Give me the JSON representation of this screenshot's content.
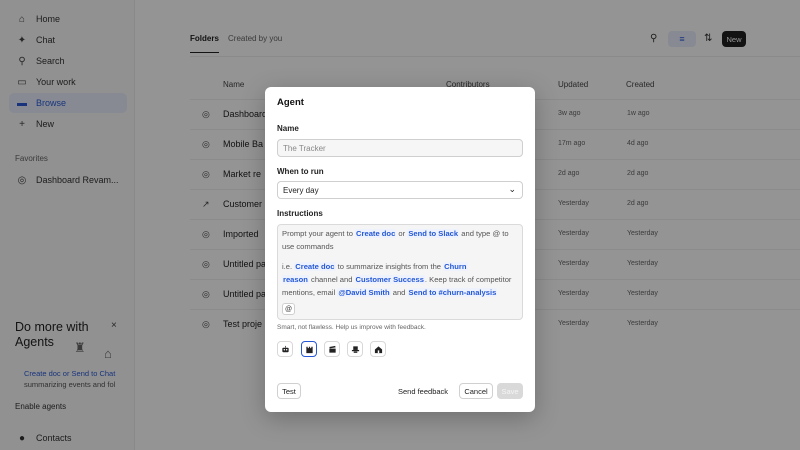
{
  "sidebar": {
    "items": [
      {
        "label": "Home",
        "icon": "home-icon",
        "glyph": "⌂"
      },
      {
        "label": "Chat",
        "icon": "sparkle-icon",
        "glyph": "✦"
      },
      {
        "label": "Search",
        "icon": "search-icon",
        "glyph": "⚲"
      },
      {
        "label": "Your work",
        "icon": "inbox-icon",
        "glyph": "▭"
      },
      {
        "label": "Browse",
        "icon": "folder-icon",
        "glyph": "▬"
      },
      {
        "label": "New",
        "icon": "plus-icon",
        "glyph": "+"
      }
    ],
    "favorites_title": "Favorites",
    "favorite_item": {
      "label": "Dashboard Revam...",
      "icon": "target-icon",
      "glyph": "◎"
    },
    "promo": {
      "title": "Do more with Agents",
      "close": "×",
      "text_1": "Create doc or Send to Chat",
      "text_2": "summarizing events and fol",
      "enable": "Enable agents"
    },
    "contacts": {
      "label": "Contacts",
      "icon": "user-icon",
      "glyph": "●"
    }
  },
  "main": {
    "tabs": [
      "Folders",
      "Created by you"
    ],
    "toolbar": {
      "search_glyph": "⚲",
      "filter_glyph": "≡",
      "sort_glyph": "⇅",
      "new_label": "New"
    },
    "columns": [
      "Name",
      "Contributors",
      "Updated",
      "Created"
    ],
    "rows": [
      {
        "name": "Dashboard",
        "icon": "target-icon",
        "glyph": "◎",
        "updated": "3w ago",
        "created": "1w ago"
      },
      {
        "name": "Mobile Ba",
        "icon": "target-icon",
        "glyph": "◎",
        "updated": "17m ago",
        "created": "4d ago"
      },
      {
        "name": "Market re",
        "icon": "target-icon",
        "glyph": "◎",
        "updated": "2d ago",
        "created": "2d ago"
      },
      {
        "name": "Customer",
        "icon": "trend-icon",
        "glyph": "↗",
        "updated": "Yesterday",
        "created": "2d ago"
      },
      {
        "name": "Imported",
        "icon": "target-icon",
        "glyph": "◎",
        "updated": "Yesterday",
        "created": "Yesterday"
      },
      {
        "name": "Untitled pa",
        "icon": "target-icon",
        "glyph": "◎",
        "updated": "Yesterday",
        "created": "Yesterday"
      },
      {
        "name": "Untitled pa",
        "icon": "target-icon",
        "glyph": "◎",
        "updated": "Yesterday",
        "created": "Yesterday"
      },
      {
        "name": "Test proje",
        "icon": "target-icon",
        "glyph": "◎",
        "updated": "Yesterday",
        "created": "Yesterday"
      }
    ]
  },
  "modal": {
    "title": "Agent",
    "name_label": "Name",
    "name_placeholder": "The Tracker",
    "when_label": "When to run",
    "when_value": "Every day",
    "instructions_label": "Instructions",
    "instr": {
      "l1a": "Prompt your agent to",
      "tk_create_doc": "Create doc",
      "l1b": "or",
      "tk_send_slack": "Send to Slack",
      "l1c": "and type @ to",
      "l2": "use commands",
      "l3a": "i.e.",
      "tk_create_doc_2": "Create doc",
      "l3b": "to summarize insights from the",
      "tk_churn": "Churn",
      "tk_reason": "reason",
      "l4a": "channel and",
      "tk_cs": "Customer Success",
      "l4b": ". Keep track of competitor",
      "l5a": "mentions, email",
      "tk_david": "@David Smith",
      "l5b": "and",
      "tk_churn_analysis": "Send to #churn-analysis",
      "at": "@"
    },
    "hint": "Smart, not flawless. Help us improve with feedback.",
    "avatars": [
      "robot-icon",
      "castle-icon",
      "clapper-icon",
      "hat-icon",
      "house-icon"
    ],
    "buttons": {
      "test": "Test",
      "feedback": "Send feedback",
      "cancel": "Cancel",
      "save": "Save"
    }
  }
}
